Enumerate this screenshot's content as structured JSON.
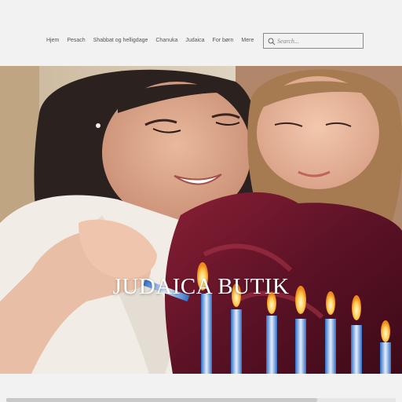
{
  "nav": {
    "items": [
      {
        "label": "Hjem",
        "active": true
      },
      {
        "label": "Pesach"
      },
      {
        "label": "Shabbat og helligdage"
      },
      {
        "label": "Chanuka"
      },
      {
        "label": "Judaica"
      },
      {
        "label": "For børn"
      },
      {
        "label": "Mere"
      }
    ]
  },
  "search": {
    "placeholder": "Search..."
  },
  "hero": {
    "title": "JUDAICA BUTIK",
    "image_icon": "photo-mother-daughter-lighting-candles"
  },
  "colors": {
    "background": "#f2f2f2",
    "nav_text": "#555555",
    "title_text": "#ffffff"
  },
  "scrollbar": {
    "position_fraction": 0.8
  }
}
